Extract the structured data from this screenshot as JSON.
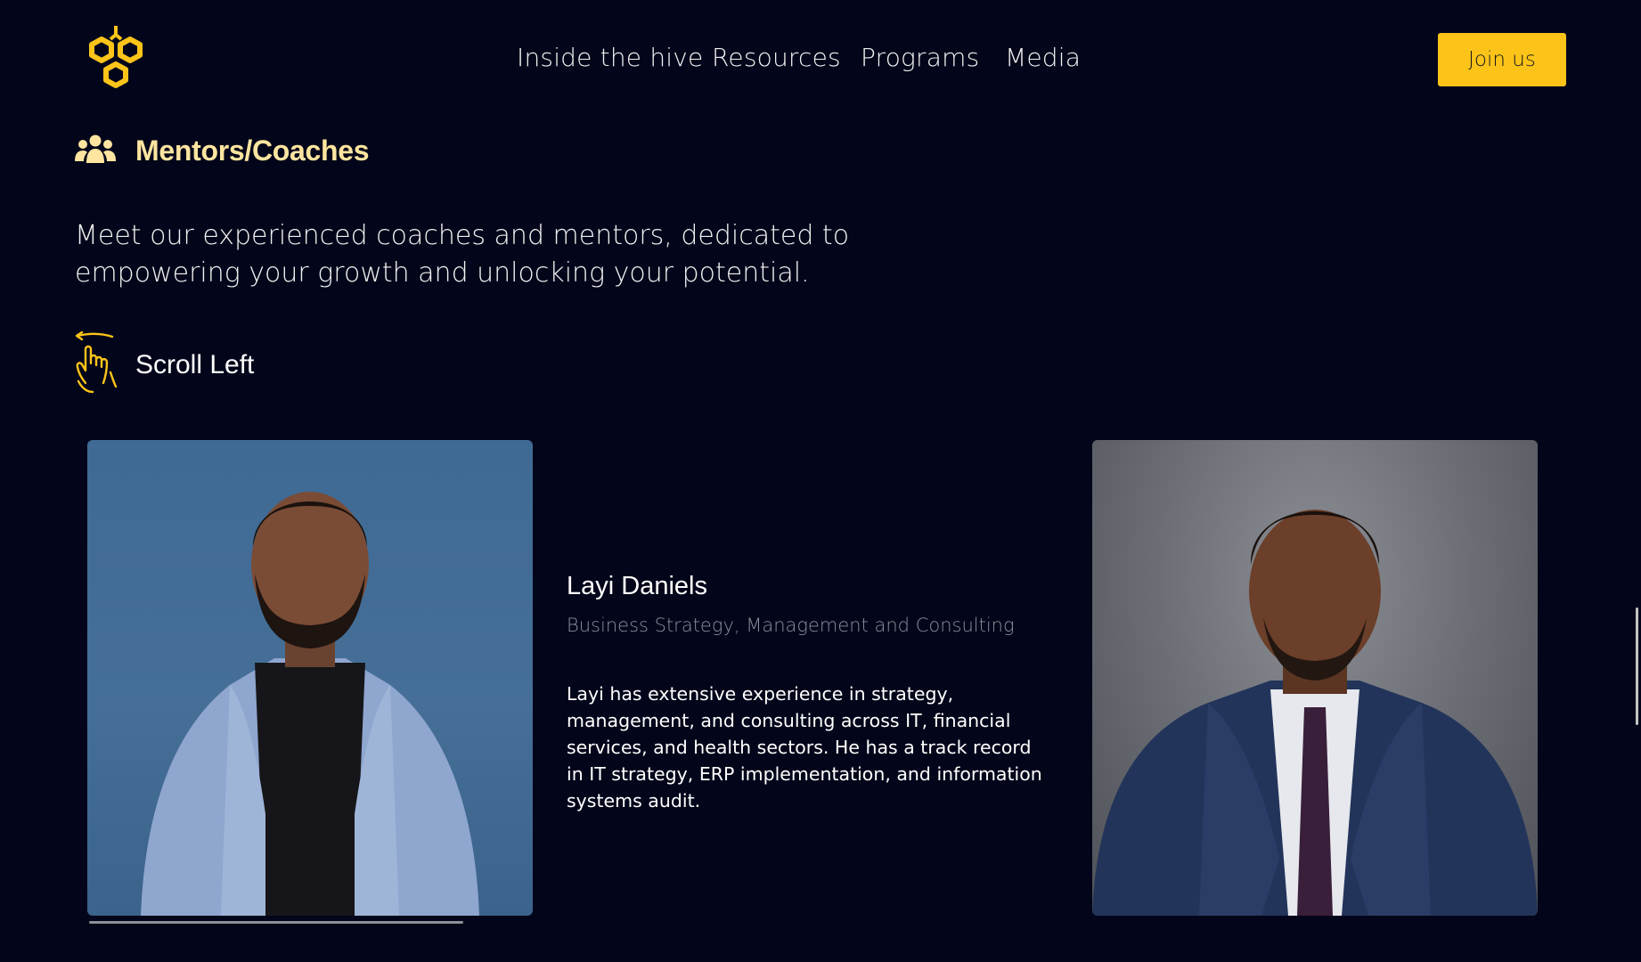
{
  "header": {
    "logo_icon": "honeycomb-logo-icon",
    "nav": [
      "Inside the hive",
      "Resources",
      "Programs",
      "Media"
    ],
    "join_label": "Join us",
    "accent_color": "#fcc419"
  },
  "section": {
    "icon": "users-group-icon",
    "title": "Mentors/Coaches",
    "intro": "Meet our experienced coaches and mentors, dedicated to empowering your growth and unlocking your potential.",
    "scroll_icon": "swipe-left-hand-icon",
    "scroll_label": "Scroll Left"
  },
  "mentors": [
    {
      "name": "Layi Daniels",
      "role": "Business Strategy, Management and Consulting",
      "bio": "Layi has extensive experience in strategy, management, and consulting across IT, financial services, and health sectors. He has a track record in IT strategy, ERP implementation, and information systems audit."
    }
  ],
  "colors": {
    "background": "#03061a",
    "title_color": "#ffe5a0",
    "muted_text": "#8a8d99"
  }
}
